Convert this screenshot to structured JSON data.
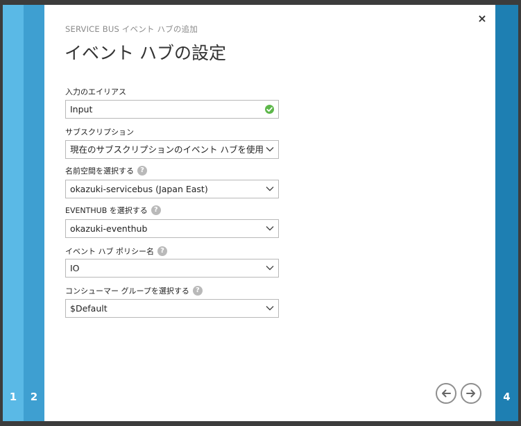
{
  "steps": {
    "step1": "1",
    "step2": "2",
    "step4": "4"
  },
  "header": {
    "subtitle": "SERVICE BUS イベント ハブの追加",
    "title": "イベント ハブの設定",
    "close_label": "×"
  },
  "form": {
    "alias": {
      "label": "入力のエイリアス",
      "value": "Input",
      "status": "valid"
    },
    "subscription": {
      "label": "サブスクリプション",
      "value": "現在のサブスクリプションのイベント ハブを使用"
    },
    "namespace": {
      "label": "名前空間を選択する",
      "value": "okazuki-servicebus (Japan East)"
    },
    "eventhub": {
      "label": "EVENTHUB を選択する",
      "value": "okazuki-eventhub"
    },
    "policy": {
      "label": "イベント ハブ ポリシー名",
      "value": "IO"
    },
    "consumer_group": {
      "label": "コンシューマー グループを選択する",
      "value": "$Default"
    },
    "help_glyph": "?"
  },
  "colors": {
    "step1": "#5ab9e6",
    "step2": "#3e9fd1",
    "step4": "#1e7fb2",
    "valid": "#5db74a"
  },
  "icons": {
    "back": "arrow-left-icon",
    "next": "arrow-right-icon",
    "close": "close-icon",
    "valid": "checkmark-icon"
  }
}
